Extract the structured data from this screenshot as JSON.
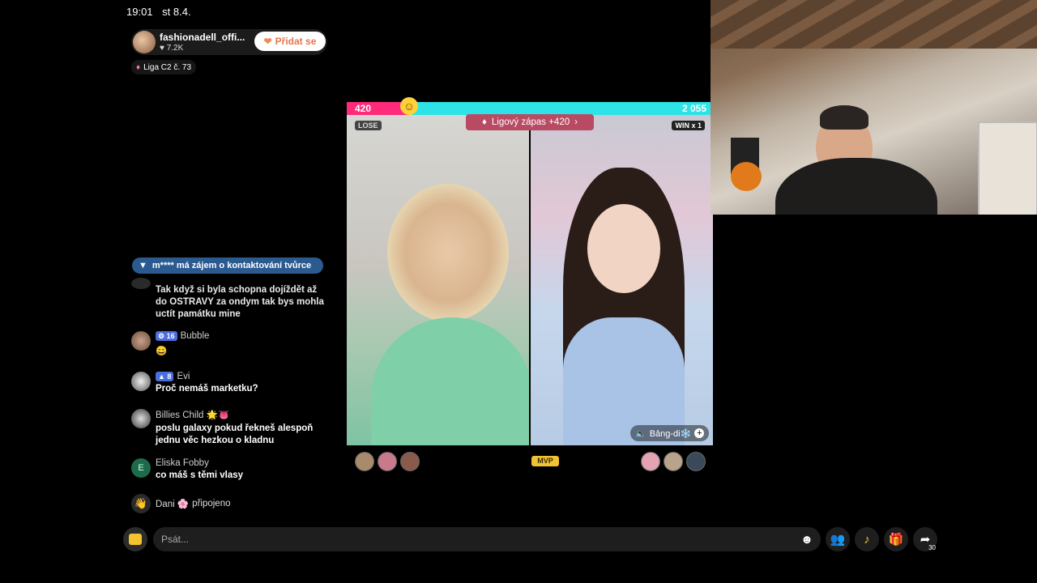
{
  "status": {
    "time": "19:01",
    "date": "st 8.4."
  },
  "host": {
    "name": "fashionadell_offi...",
    "likes": "7.2K",
    "follow_label": "Přidat se"
  },
  "league": {
    "label": "Liga C2 č. 73"
  },
  "banner": {
    "text": "m**** má zájem o kontaktování tvůrce"
  },
  "chat": [
    {
      "user": "",
      "level": "",
      "text": "Tak když si byla schopna dojíždět až do OSTRAVY  za ondym tak bys mohla uctít památku mine"
    },
    {
      "user": "Bubble",
      "level": "16",
      "text": "😄"
    },
    {
      "user": "Evi",
      "level": "8",
      "text": "Proč nemáš marketku?"
    },
    {
      "user": "Billies Child 🌟👅",
      "level": "",
      "text": "poslu galaxy pokud řekneš alespoň jednu věc hezkou o kladnu"
    },
    {
      "user": "Eliska Fobby",
      "level": "",
      "avatar_letter": "E",
      "text": "co máš s těmi vlasy"
    }
  ],
  "joined": {
    "user": "Dani 🌸",
    "text": "připojeno"
  },
  "battle": {
    "left_score": "420",
    "right_score": "2 055",
    "left_score_value": 420,
    "right_score_value": 2055,
    "lose_label": "LOSE",
    "win_label": "WIN x 1",
    "match_label": "Ligový zápas +420",
    "bang_label": "Bảng-di❄️",
    "mvp_label": "MVP"
  },
  "input": {
    "placeholder": "Psát..."
  },
  "share_count": "30",
  "colors": {
    "accent": "#e6764d",
    "bar_left": "#ff2a7a",
    "bar_right": "#2de3e6",
    "banner": "#2a5a8f"
  }
}
